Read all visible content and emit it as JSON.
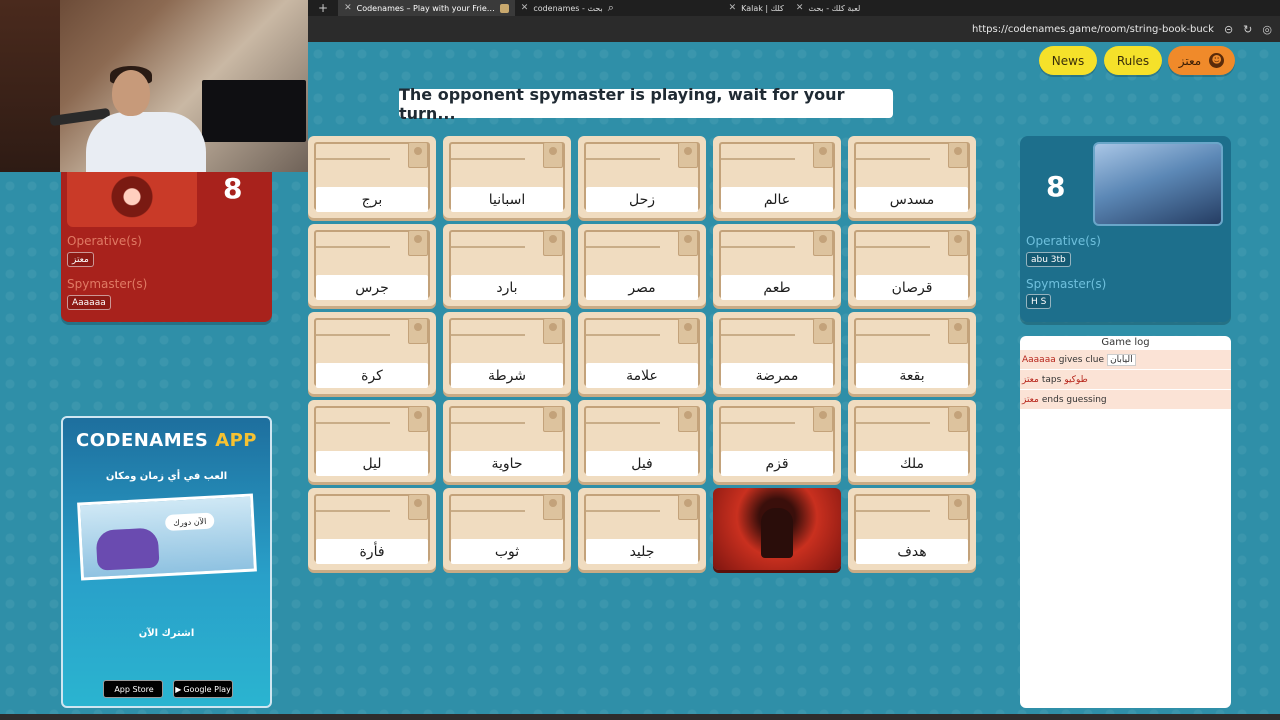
{
  "browser": {
    "tabs": [
      {
        "label": "Codenames – Play with your Frie…",
        "active": true
      },
      {
        "label": "codenames - بحث",
        "active": false
      },
      {
        "label": "Kalak | كلك",
        "active": false
      },
      {
        "label": "لعبة كلك - بحث",
        "active": false
      }
    ],
    "url": "https://codenames.game/room/string-book-buck"
  },
  "header": {
    "news_label": "News",
    "rules_label": "Rules",
    "user_label": "معتز"
  },
  "status_banner": "The opponent spymaster is playing, wait for your turn...",
  "red_team": {
    "score": "8",
    "operatives_label": "Operative(s)",
    "operatives": [
      "معتز"
    ],
    "spymaster_label": "Spymaster(s)",
    "spymasters": [
      "Aaaaaa"
    ]
  },
  "blue_team": {
    "score": "8",
    "operatives_label": "Operative(s)",
    "operatives": [
      "abu 3tb"
    ],
    "spymaster_label": "Spymaster(s)",
    "spymasters": [
      "H S"
    ]
  },
  "board": {
    "cards": [
      {
        "word": "برج"
      },
      {
        "word": "اسبانيا"
      },
      {
        "word": "زحل"
      },
      {
        "word": "عالم"
      },
      {
        "word": "مسدس"
      },
      {
        "word": "جرس"
      },
      {
        "word": "بارد"
      },
      {
        "word": "مصر"
      },
      {
        "word": "طعم"
      },
      {
        "word": "قرصان"
      },
      {
        "word": "كرة"
      },
      {
        "word": "شرطة"
      },
      {
        "word": "علامة"
      },
      {
        "word": "ممرضة"
      },
      {
        "word": "بقعة"
      },
      {
        "word": "ليل"
      },
      {
        "word": "حاوية"
      },
      {
        "word": "فيل"
      },
      {
        "word": "قزم"
      },
      {
        "word": "ملك"
      },
      {
        "word": "فأرة"
      },
      {
        "word": "ثوب"
      },
      {
        "word": "جليد"
      },
      {
        "word": "",
        "revealed": "red"
      },
      {
        "word": "هدف"
      }
    ]
  },
  "game_log": {
    "title": "Game log",
    "entries": [
      {
        "name": "Aaaaaa",
        "text": "gives clue",
        "clue": "اليابان"
      },
      {
        "name": "معتز",
        "text": "taps",
        "clue": "طوكيو"
      },
      {
        "name": "معتز",
        "text": "ends guessing",
        "clue": ""
      }
    ]
  },
  "promo": {
    "title_main": "CODENAMES",
    "title_accent": "APP",
    "tagline": "العب في أي زمان ومكان",
    "bubble": "الآن دورك",
    "cta": "اشترك الآن",
    "app_store": "App Store",
    "google_play": "Google Play"
  },
  "colors": {
    "background": "#2f8fa8",
    "red_team": "#a8221c",
    "blue_team": "#1d6f8c",
    "button_yellow": "#f5e12a",
    "button_orange": "#f08a2a"
  }
}
